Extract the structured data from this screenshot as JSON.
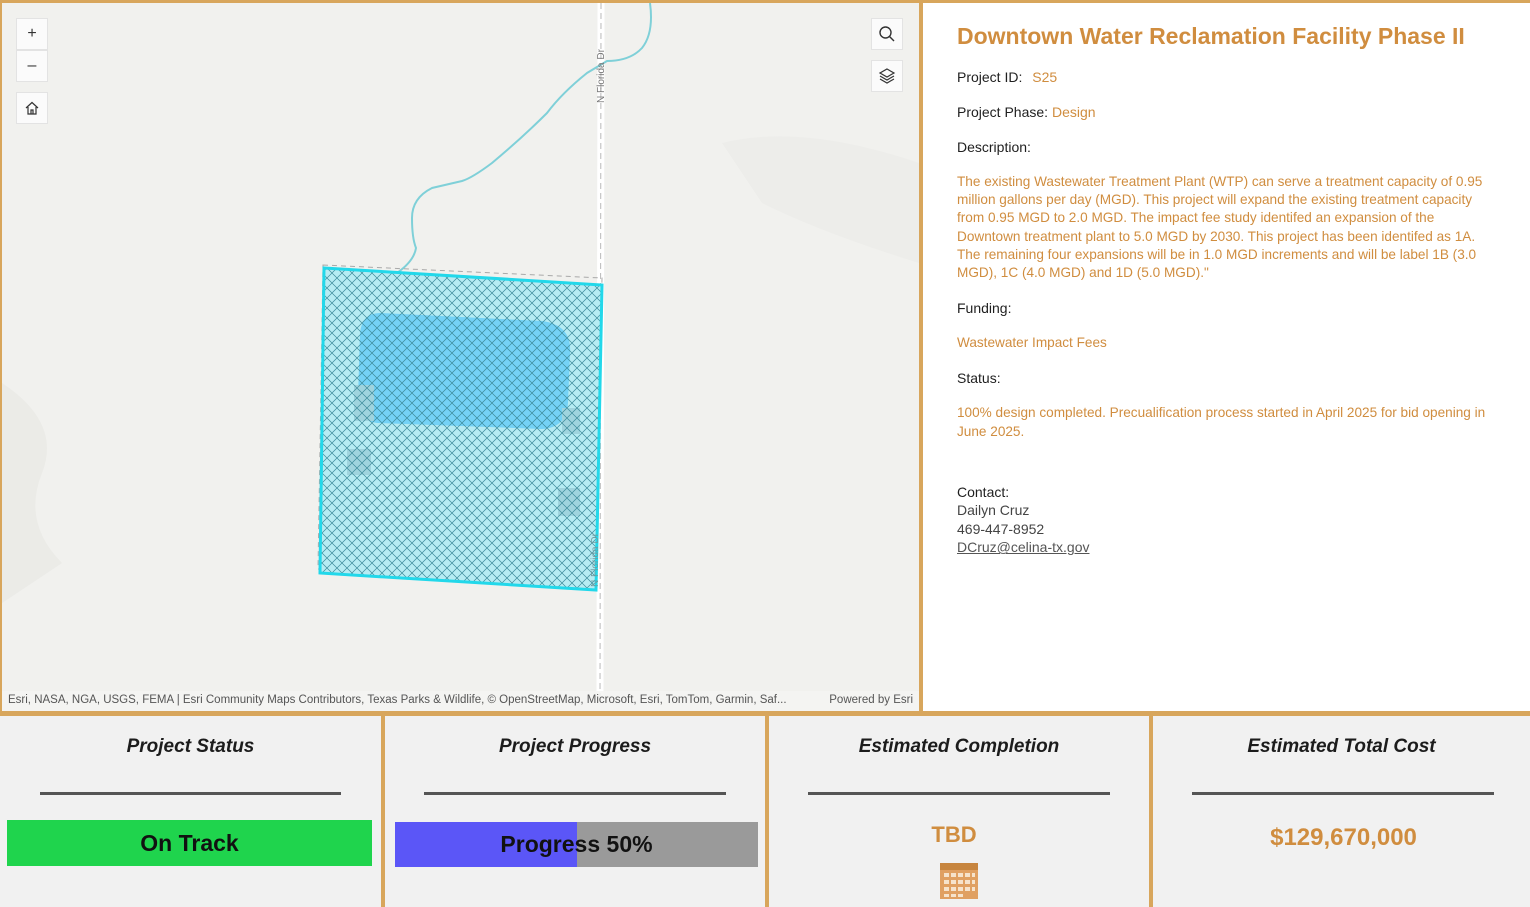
{
  "map": {
    "road_label_top": "N Florida Dr",
    "road_label_bottom": "N Florida Dr",
    "attribution": "Esri, NASA, NGA, USGS, FEMA | Esri Community Maps Contributors, Texas Parks & Wildlife, © OpenStreetMap, Microsoft, Esri, TomTom, Garmin, Saf...",
    "powered_by": "Powered by Esri",
    "zoom_in_label": "+",
    "zoom_out_label": "–",
    "colors": {
      "parcel": "#22d8ea",
      "stream": "#7fd0d8",
      "pond": "#74d2f6"
    }
  },
  "info": {
    "title": "Downtown Water Reclamation Facility Phase II",
    "project_id_label": "Project ID:",
    "project_id": "S25",
    "phase_label": "Project Phase:",
    "phase": "Design",
    "description_label": "Description:",
    "description": "The existing Wastewater Treatment Plant (WTP) can serve a treatment capacity of 0.95 million gallons per day (MGD). This project will expand the existing treatment capacity from 0.95 MGD to 2.0 MGD. The impact fee study identifed an expansion of the Downtown treatment plant to 5.0 MGD by 2030. This project has been identifed as 1A. The remaining four expansions will be in 1.0 MGD increments and will be label 1B (3.0 MGD), 1C (4.0 MGD) and 1D (5.0 MGD).\"",
    "funding_label": "Funding:",
    "funding": "Wastewater Impact Fees",
    "status_label": "Status:",
    "status": "100% design completed. Precualification process started in April 2025 for bid opening in June 2025.",
    "contact_label": "Contact:",
    "contact_name": "Dailyn Cruz",
    "contact_phone": "469-447-8952",
    "contact_email": "DCruz@celina-tx.gov",
    "accent_color": "#d08d3f"
  },
  "cards": {
    "status_title": "Project Status",
    "status_value": "On Track",
    "status_color": "#1fd44d",
    "progress_title": "Project Progress",
    "progress_text": "Progress 50%",
    "progress_fraction": 0.5,
    "progress_color": "#5b56f7",
    "completion_title": "Estimated Completion",
    "completion_value": "TBD",
    "completion_icon": "calendar-icon",
    "cost_title": "Estimated Total Cost",
    "cost_value": "$129,670,000"
  }
}
